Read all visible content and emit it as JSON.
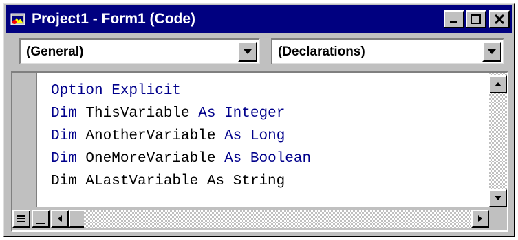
{
  "window": {
    "title": "Project1 - Form1 (Code)"
  },
  "combos": {
    "object": "(General)",
    "procedure": "(Declarations)"
  },
  "code_lines": [
    [
      {
        "t": "Option Explicit",
        "k": true
      }
    ],
    [
      {
        "t": "Dim",
        "k": true
      },
      {
        "t": " ThisVariable ",
        "k": false
      },
      {
        "t": "As",
        "k": true
      },
      {
        "t": " ",
        "k": false
      },
      {
        "t": "Integer",
        "k": true
      }
    ],
    [
      {
        "t": "Dim",
        "k": true
      },
      {
        "t": " AnotherVariable ",
        "k": false
      },
      {
        "t": "As",
        "k": true
      },
      {
        "t": " ",
        "k": false
      },
      {
        "t": "Long",
        "k": true
      }
    ],
    [
      {
        "t": "Dim",
        "k": true
      },
      {
        "t": " OneMoreVariable ",
        "k": false
      },
      {
        "t": "As",
        "k": true
      },
      {
        "t": " ",
        "k": false
      },
      {
        "t": "Boolean",
        "k": true
      }
    ],
    [
      {
        "t": "Dim ALastVariable As String",
        "k": false
      }
    ]
  ],
  "colors": {
    "titlebar": "#000080",
    "keyword": "#00008b",
    "text": "#000000",
    "face": "#c0c0c0"
  }
}
